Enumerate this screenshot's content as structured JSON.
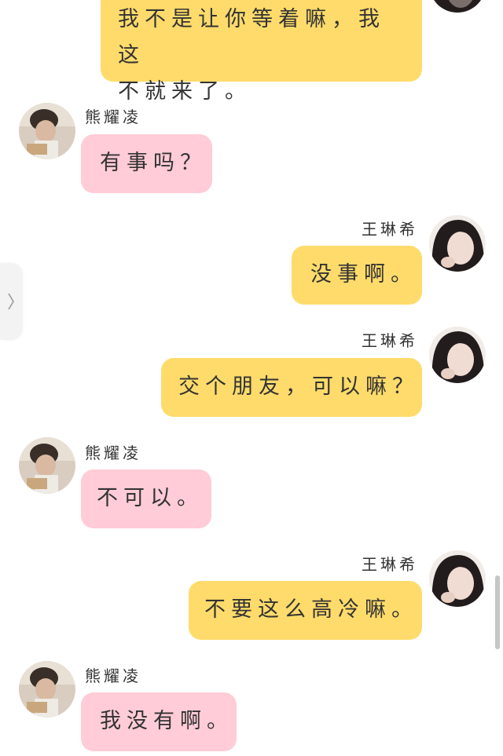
{
  "messages": [
    {
      "side": "me",
      "sender": "",
      "text": "我不是让你等着嘛，我这不就来了。",
      "lines": [
        "我不是让你等着嘛，我这",
        "不就来了。"
      ]
    },
    {
      "side": "them",
      "sender": "熊耀凌",
      "text": "有事吗？"
    },
    {
      "side": "me",
      "sender": "王琳希",
      "text": "没事啊。"
    },
    {
      "side": "me",
      "sender": "王琳希",
      "text": "交个朋友，可以嘛？"
    },
    {
      "side": "them",
      "sender": "熊耀凌",
      "text": "不可以。"
    },
    {
      "side": "me",
      "sender": "王琳希",
      "text": "不要这么高冷嘛。"
    },
    {
      "side": "them",
      "sender": "熊耀凌",
      "text": "我没有啊。"
    }
  ],
  "colors": {
    "me_bubble": "#fedb6b",
    "them_bubble": "#ffccd7"
  },
  "icons": {
    "side_tab": "chevron-right-icon"
  }
}
